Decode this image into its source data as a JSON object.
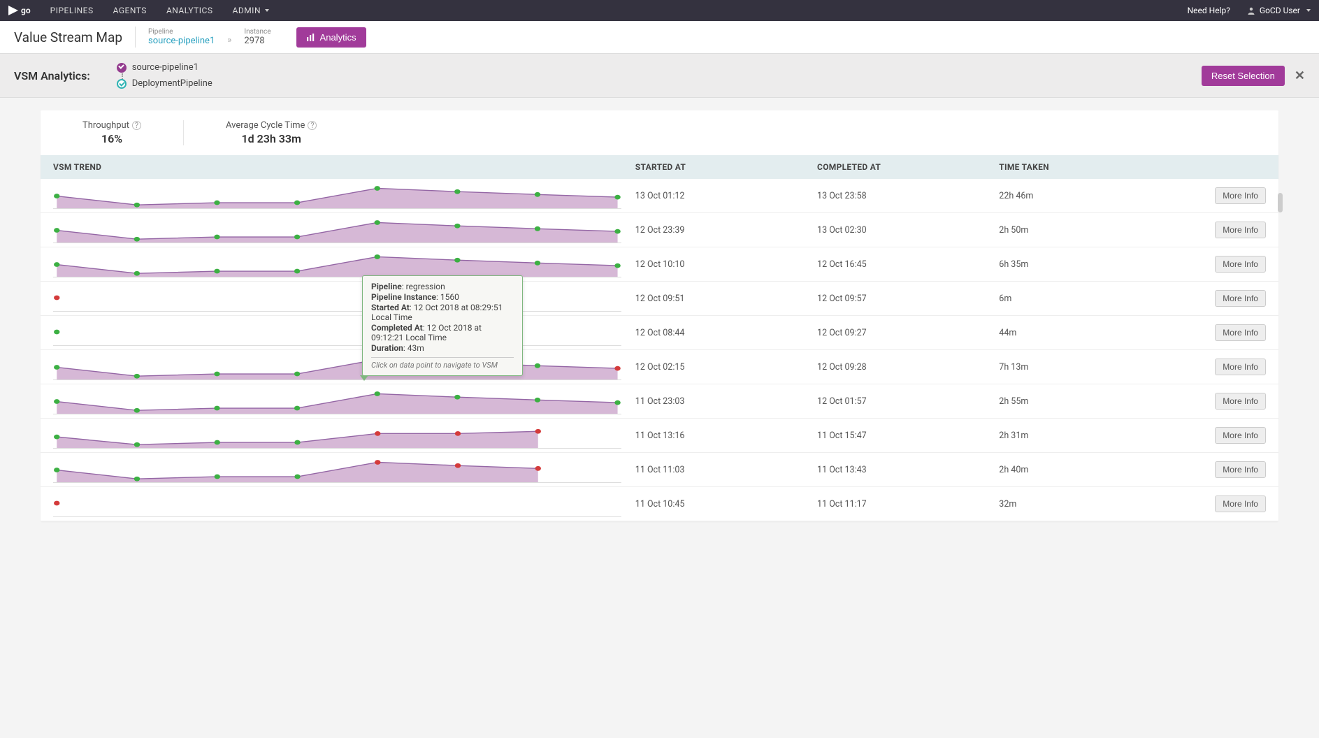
{
  "nav": {
    "logo": "go",
    "items": [
      "PIPELINES",
      "AGENTS",
      "ANALYTICS",
      "ADMIN"
    ],
    "help": "Need Help?",
    "user": "GoCD User"
  },
  "subheader": {
    "title": "Value Stream Map",
    "pipeline_label": "Pipeline",
    "pipeline_name": "source-pipeline1",
    "instance_label": "Instance",
    "instance_value": "2978",
    "analytics_btn": "Analytics"
  },
  "vsmbar": {
    "title": "VSM Analytics:",
    "pipelines": [
      {
        "name": "source-pipeline1",
        "status": "purple"
      },
      {
        "name": "DeploymentPipeline",
        "status": "teal"
      }
    ],
    "reset": "Reset Selection"
  },
  "stats": {
    "throughput_label": "Throughput",
    "throughput_value": "16%",
    "cycle_label": "Average Cycle Time",
    "cycle_value": "1d 23h 33m"
  },
  "table": {
    "headers": {
      "trend": "VSM TREND",
      "started": "STARTED AT",
      "completed": "COMPLETED AT",
      "time": "TIME TAKEN"
    },
    "more_info": "More Info",
    "rows": [
      {
        "started": "13 Oct 01:12",
        "completed": "13 Oct 23:58",
        "time": "22h 46m",
        "variant": "full_green"
      },
      {
        "started": "12 Oct 23:39",
        "completed": "13 Oct 02:30",
        "time": "2h 50m",
        "variant": "full_green"
      },
      {
        "started": "12 Oct 10:10",
        "completed": "12 Oct 16:45",
        "time": "6h 35m",
        "variant": "full_green"
      },
      {
        "started": "12 Oct 09:51",
        "completed": "12 Oct 09:57",
        "time": "6m",
        "variant": "single_red"
      },
      {
        "started": "12 Oct 08:44",
        "completed": "12 Oct 09:27",
        "time": "44m",
        "variant": "single_green"
      },
      {
        "started": "12 Oct 02:15",
        "completed": "12 Oct 09:28",
        "time": "7h 13m",
        "variant": "green_redlast",
        "tooltip_anchor": true
      },
      {
        "started": "11 Oct 23:03",
        "completed": "12 Oct 01:57",
        "time": "2h 55m",
        "variant": "full_green"
      },
      {
        "started": "11 Oct 13:16",
        "completed": "11 Oct 15:47",
        "time": "2h 31m",
        "variant": "red_mid_short"
      },
      {
        "started": "11 Oct 11:03",
        "completed": "11 Oct 13:43",
        "time": "2h 40m",
        "variant": "red_mid"
      },
      {
        "started": "11 Oct 10:45",
        "completed": "11 Oct 11:17",
        "time": "32m",
        "variant": "single_red"
      }
    ]
  },
  "tooltip": {
    "pipeline_k": "Pipeline",
    "pipeline_v": ": regression",
    "instance_k": "Pipeline Instance",
    "instance_v": ": 1560",
    "started_k": "Started At",
    "started_v": ": 12 Oct 2018 at 08:29:51 Local Time",
    "completed_k": "Completed At",
    "completed_v": ": 12 Oct 2018 at 09:12:21 Local Time",
    "duration_k": "Duration",
    "duration_v": ": 43m",
    "hint": "Click on data point to navigate to VSM"
  },
  "chart_data": {
    "type": "area",
    "description": "Sparkline area charts per VSM run; x = pipeline stage index (0–7), y = relative duration (0–1, normalized). Points colored green=passed, red=failed.",
    "shapes": {
      "full_green": {
        "y": [
          0.55,
          0.95,
          0.85,
          0.85,
          0.2,
          0.35,
          0.48,
          0.6
        ],
        "colors": [
          "g",
          "g",
          "g",
          "g",
          "g",
          "g",
          "g",
          "g"
        ],
        "fill": true
      },
      "green_redlast": {
        "y": [
          0.55,
          0.95,
          0.85,
          0.85,
          0.2,
          0.35,
          0.48,
          0.6
        ],
        "colors": [
          "g",
          "g",
          "g",
          "g",
          "g",
          "g",
          "g",
          "r"
        ],
        "fill": true
      },
      "red_mid": {
        "y": [
          0.55,
          0.95,
          0.85,
          0.85,
          0.2,
          0.35,
          0.48
        ],
        "colors": [
          "g",
          "g",
          "g",
          "g",
          "r",
          "r",
          "r"
        ],
        "fill": true,
        "span": 0.86
      },
      "red_mid_short": {
        "y": [
          0.6,
          0.95,
          0.85,
          0.85,
          0.45,
          0.45,
          0.35
        ],
        "colors": [
          "g",
          "g",
          "g",
          "g",
          "r",
          "r",
          "r"
        ],
        "fill": true,
        "span": 0.86
      },
      "single_red": {
        "y": [
          0.5
        ],
        "colors": [
          "r"
        ],
        "fill": false
      },
      "single_green": {
        "y": [
          0.5
        ],
        "colors": [
          "g"
        ],
        "fill": false
      }
    },
    "ylim": [
      0,
      1
    ]
  }
}
